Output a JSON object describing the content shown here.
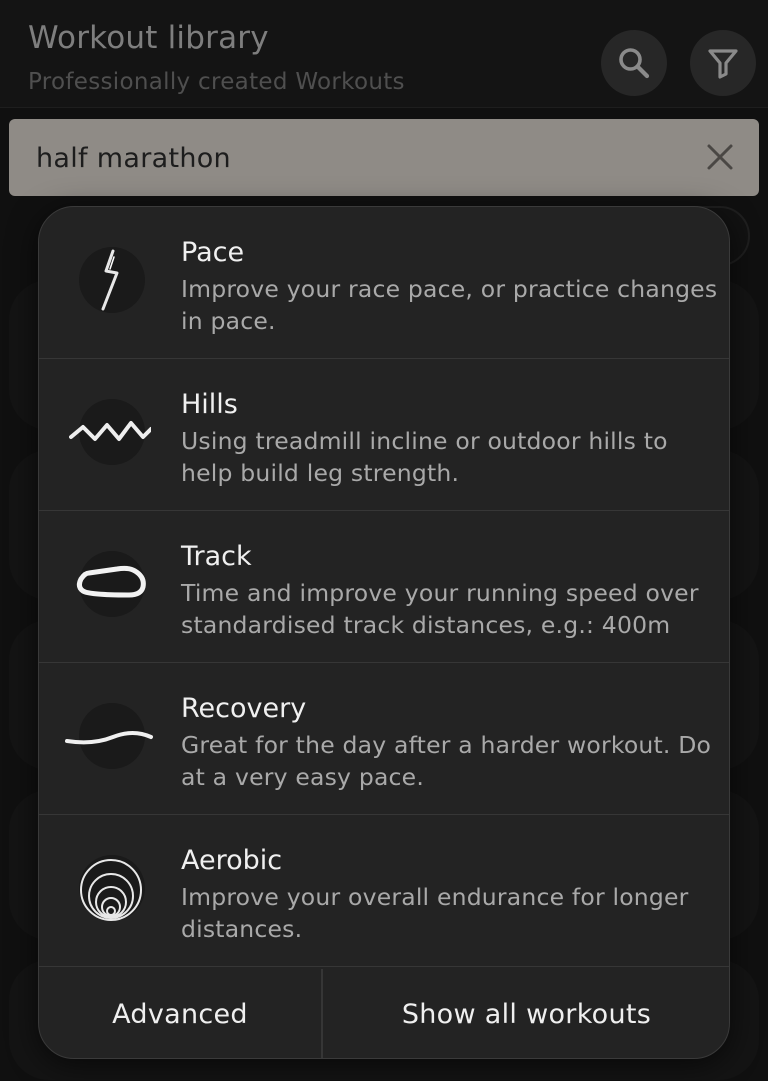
{
  "header": {
    "title": "Workout library",
    "subtitle": "Professionally created Workouts"
  },
  "search": {
    "value": "half marathon"
  },
  "menu": {
    "items": [
      {
        "name": "Pace",
        "description": "Improve your race pace, or practice changes in pace.",
        "icon": "pace-bolt-icon"
      },
      {
        "name": "Hills",
        "description": "Using treadmill incline or outdoor hills to help build leg strength.",
        "icon": "hills-zigzag-icon"
      },
      {
        "name": "Track",
        "description": "Time and improve your running speed over standardised track distances, e.g.: 400m",
        "icon": "track-oval-icon"
      },
      {
        "name": "Recovery",
        "description": "Great for the day after a harder workout. Do at a very easy pace.",
        "icon": "recovery-wave-icon"
      },
      {
        "name": "Aerobic",
        "description": "Improve your overall endurance for longer distances.",
        "icon": "aerobic-rings-icon"
      }
    ],
    "footer": {
      "advanced": "Advanced",
      "show_all": "Show all workouts"
    }
  },
  "colors": {
    "background": "#101010",
    "popup": "#232323",
    "search_bar": "#8f8b86"
  }
}
